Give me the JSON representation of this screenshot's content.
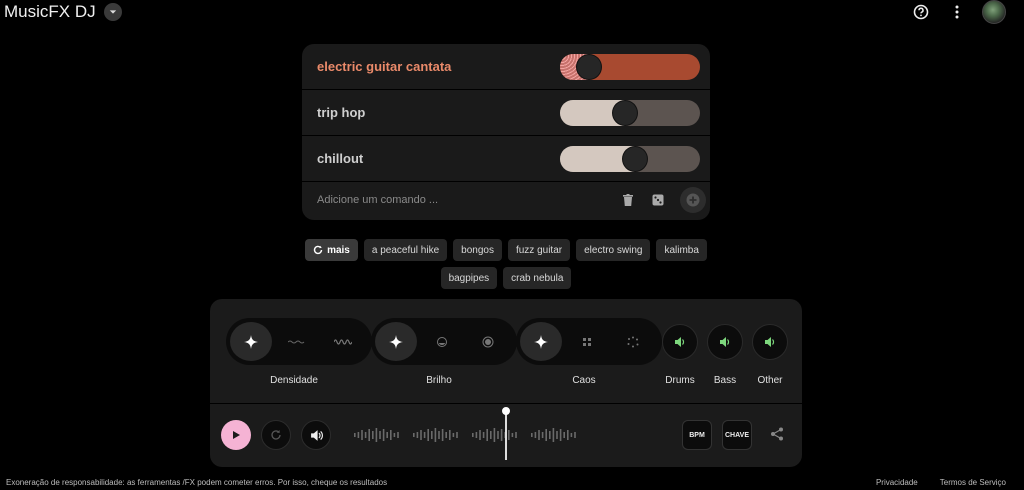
{
  "header": {
    "title": "MusicFX DJ",
    "icons": [
      "help-icon",
      "more-vert-icon",
      "avatar"
    ]
  },
  "prompts": [
    {
      "label": "electric guitar cantata",
      "weight": 0.15,
      "active": true,
      "color": "#a84a30"
    },
    {
      "label": "trip hop",
      "weight": 0.46,
      "active": false,
      "color": "#5c5450"
    },
    {
      "label": "chillout",
      "weight": 0.54,
      "active": false,
      "color": "#5c5450"
    }
  ],
  "command": {
    "placeholder": "Adicione um comando ..."
  },
  "chips": {
    "more_label": "mais",
    "items": [
      "a peaceful hike",
      "bongos",
      "fuzz guitar",
      "electro swing",
      "kalimba",
      "bagpipes",
      "crab nebula"
    ]
  },
  "controls": {
    "density_label": "Densidade",
    "brightness_label": "Brilho",
    "chaos_label": "Caos",
    "stems": [
      {
        "label": "Drums"
      },
      {
        "label": "Bass"
      },
      {
        "label": "Other"
      }
    ]
  },
  "transport": {
    "bpm_label": "BPM",
    "key_label": "CHAVE"
  },
  "footer": {
    "disclaimer": "Exoneração de responsabilidade: as ferramentas /FX podem cometer erros. Por isso, cheque os resultados",
    "privacy": "Privacidade",
    "terms": "Termos de Serviço"
  },
  "colors": {
    "accent_orange": "#ea8a6a",
    "play_pink": "#f5b3d4",
    "stem_green": "#7dd87d"
  }
}
